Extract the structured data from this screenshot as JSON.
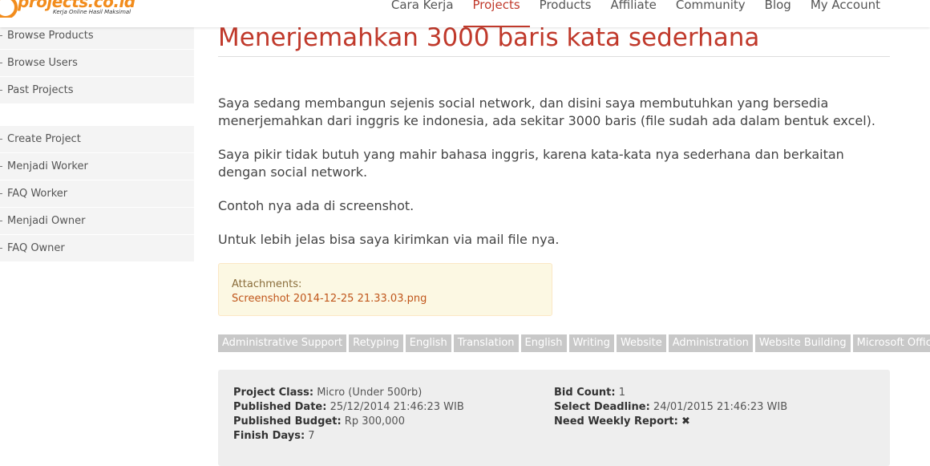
{
  "logo": {
    "text": "projects.co.id",
    "tagline": "Kerja Online Hasil Maksimal"
  },
  "nav": [
    {
      "label": "Cara Kerja"
    },
    {
      "label": "Projects",
      "active": true
    },
    {
      "label": "Products"
    },
    {
      "label": "Affiliate"
    },
    {
      "label": "Community"
    },
    {
      "label": "Blog"
    },
    {
      "label": "My Account"
    }
  ],
  "sidebar": {
    "group1": [
      "Browse Products",
      "Browse Users",
      "Past Projects"
    ],
    "group2": [
      "Create Project",
      "Menjadi Worker",
      "FAQ Worker",
      "Menjadi Owner",
      "FAQ Owner"
    ]
  },
  "project": {
    "title": "Menerjemahkan 3000 baris kata sederhana",
    "paragraphs": [
      "Saya sedang membangun sejenis social network, dan disini saya membutuhkan yang bersedia menerjemahkan dari inggris ke indonesia, ada sekitar 3000 baris (file sudah ada dalam bentuk excel).",
      "Saya pikir tidak butuh yang mahir bahasa inggris, karena kata-kata nya sederhana dan berkaitan dengan social network.",
      "Contoh nya ada di screenshot.",
      "Untuk lebih jelas bisa saya kirimkan via mail file nya."
    ],
    "attachments_label": "Attachments:",
    "attachment_file": "Screenshot 2014-12-25 21.33.03.png",
    "tags": [
      "Administrative Support",
      "Retyping",
      "English",
      "Translation",
      "English",
      "Writing",
      "Website",
      "Administration",
      "Website Building",
      "Microsoft Office"
    ]
  },
  "info": {
    "project_class_label": "Project Class:",
    "project_class": "Micro (Under 500rb)",
    "published_date_label": "Published Date:",
    "published_date": "25/12/2014 21:46:23 WIB",
    "published_budget_label": "Published Budget:",
    "published_budget": "Rp 300,000",
    "finish_days_label": "Finish Days:",
    "finish_days": "7",
    "bid_count_label": "Bid Count:",
    "bid_count": "1",
    "select_deadline_label": "Select Deadline:",
    "select_deadline": "24/01/2015 21:46:23 WIB",
    "weekly_report_label": "Need Weekly Report:",
    "weekly_report_icon": "close-icon"
  }
}
